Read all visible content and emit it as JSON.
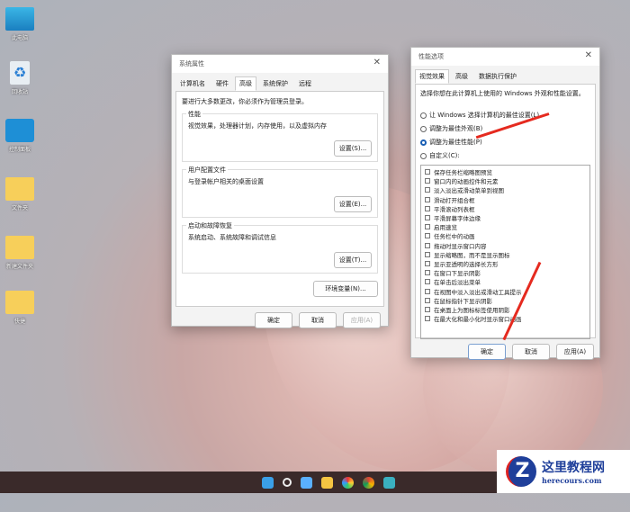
{
  "desktop": {
    "icons": [
      "此电脑",
      "回收站",
      "控制面板",
      "文件夹",
      "新建文件夹",
      "快捷"
    ]
  },
  "sys_props": {
    "title": "系统属性",
    "tabs": [
      "计算机名",
      "硬件",
      "高级",
      "系统保护",
      "远程"
    ],
    "active_tab": 2,
    "admin_note": "要进行大多数更改，你必须作为管理员登录。",
    "groups": [
      {
        "label": "性能",
        "desc": "视觉效果，处理器计划，内存使用，以及虚拟内存",
        "button": "设置(S)..."
      },
      {
        "label": "用户配置文件",
        "desc": "与登录帐户相关的桌面设置",
        "button": "设置(E)..."
      },
      {
        "label": "启动和故障恢复",
        "desc": "系统启动、系统故障和调试信息",
        "button": "设置(T)..."
      }
    ],
    "env_button": "环境变量(N)...",
    "ok": "确定",
    "cancel": "取消",
    "apply": "应用(A)"
  },
  "perf_opts": {
    "title": "性能选项",
    "tabs": [
      "视觉效果",
      "高级",
      "数据执行保护"
    ],
    "active_tab": 0,
    "intro": "选择你想在此计算机上使用的 Windows 外观和性能设置。",
    "radios": [
      {
        "label": "让 Windows 选择计算机的最佳设置(L)",
        "selected": false
      },
      {
        "label": "调整为最佳外观(B)",
        "selected": false
      },
      {
        "label": "调整为最佳性能(P)",
        "selected": true
      },
      {
        "label": "自定义(C):",
        "selected": false
      }
    ],
    "checkboxes": [
      "保存任务栏缩略图预览",
      "窗口内的动画控件和元素",
      "淡入淡出或滑动菜单到视图",
      "滑动打开组合框",
      "平滑滚动列表框",
      "平滑屏幕字体边缘",
      "启用速览",
      "任务栏中的动画",
      "拖动时显示窗口内容",
      "显示缩略图，而不是显示图标",
      "显示亚透明的选择长方形",
      "在窗口下显示阴影",
      "在单击后淡出菜单",
      "在视图中淡入淡出或滑动工具提示",
      "在鼠标指针下显示阴影",
      "在桌面上为图标标签使用阴影",
      "在最大化和最小化时显示窗口动画"
    ],
    "ok": "确定",
    "cancel": "取消",
    "apply": "应用(A)"
  },
  "watermark": {
    "title": "这里教程网",
    "url": "herecours.com"
  },
  "colors": {
    "arrow": "#e52a1f",
    "taskbar": "#3a2a2a"
  }
}
